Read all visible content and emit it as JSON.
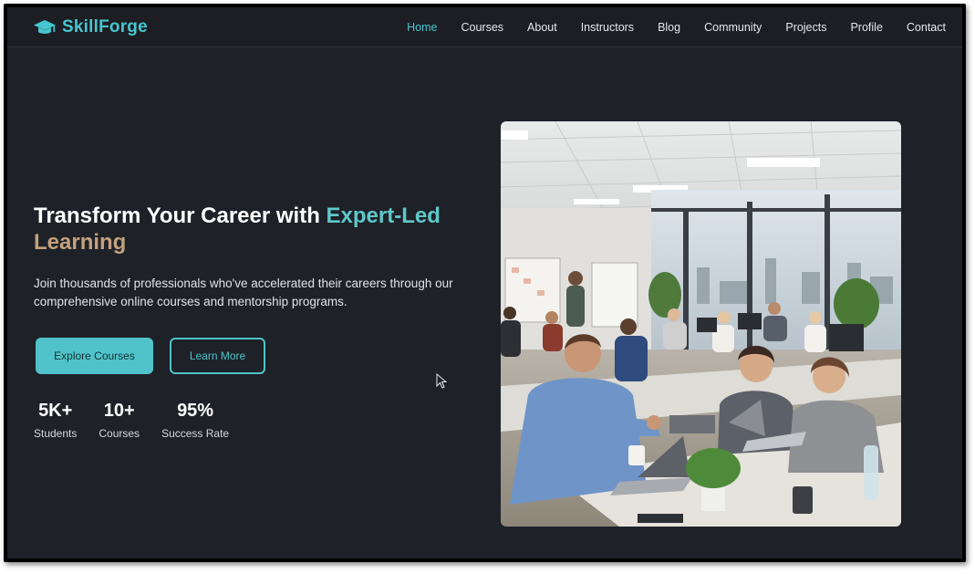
{
  "brand": {
    "name": "SkillForge",
    "icon": "graduation-cap-icon",
    "color": "#47c6cf"
  },
  "nav": {
    "items": [
      {
        "label": "Home",
        "active": true
      },
      {
        "label": "Courses"
      },
      {
        "label": "About"
      },
      {
        "label": "Instructors"
      },
      {
        "label": "Blog"
      },
      {
        "label": "Community"
      },
      {
        "label": "Projects"
      },
      {
        "label": "Profile"
      },
      {
        "label": "Contact"
      }
    ]
  },
  "hero": {
    "title_part1": "Transform Your Career with ",
    "title_accent1": "Expert-Led",
    "title_accent2": "Learning",
    "subtitle": "Join thousands of professionals who've accelerated their careers through our comprehensive online courses and mentorship programs.",
    "primary_button": "Explore Courses",
    "secondary_button": "Learn More",
    "image_alt": "people-collaborating-in-office-photo"
  },
  "stats": [
    {
      "value": "5K+",
      "label": "Students"
    },
    {
      "value": "10+",
      "label": "Courses"
    },
    {
      "value": "95%",
      "label": "Success Rate"
    }
  ],
  "colors": {
    "accent": "#4fc3c9",
    "accent_gold": "#c4a17f",
    "background": "#1f2128"
  }
}
